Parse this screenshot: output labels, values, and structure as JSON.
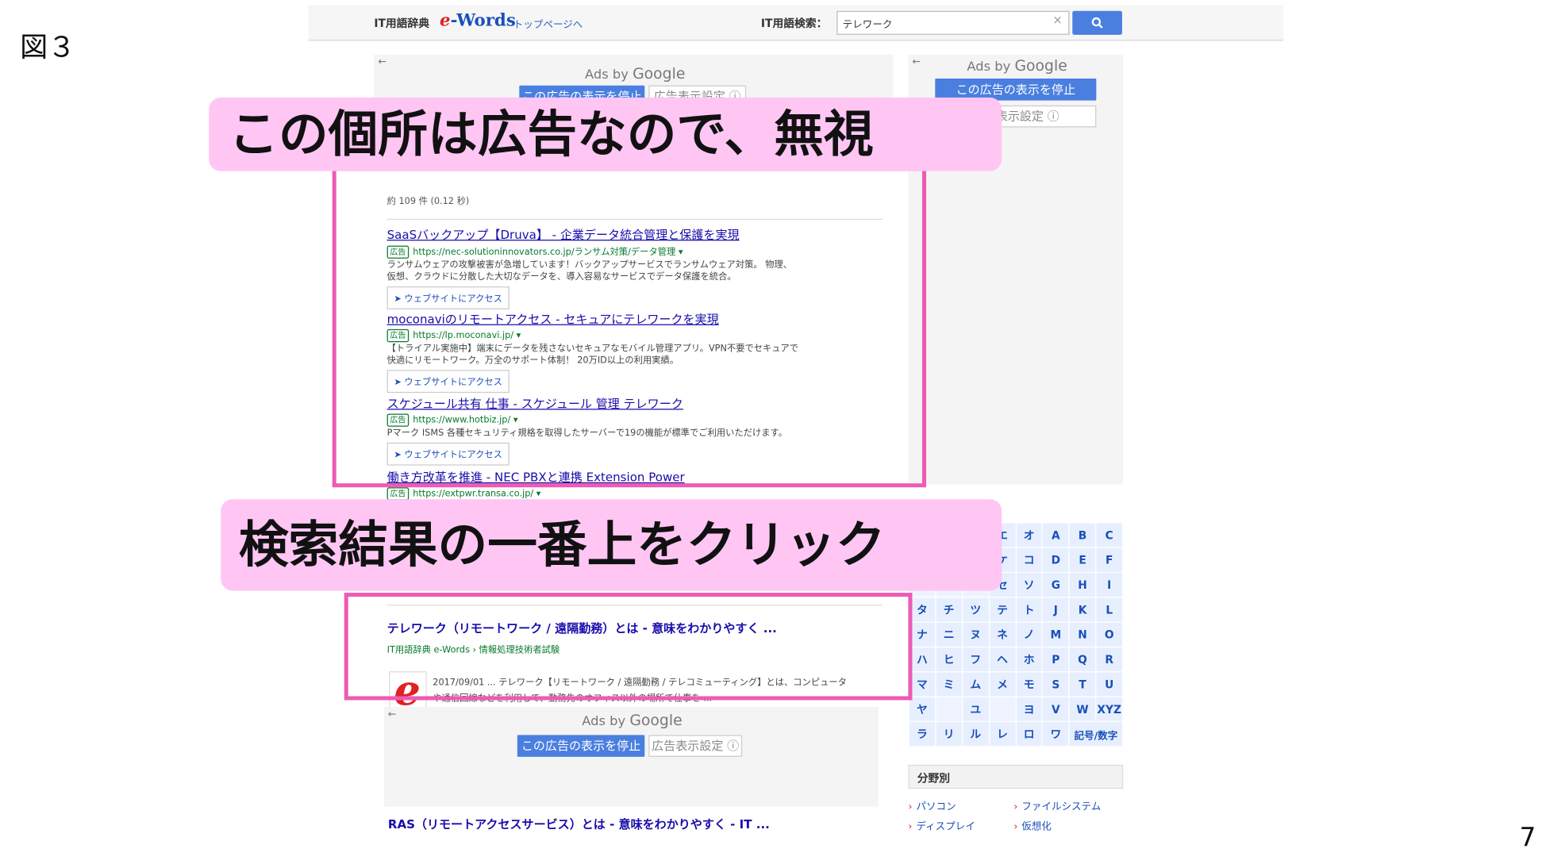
{
  "figure_label": "図３",
  "page_number": "7",
  "header": {
    "brand_label": "IT用語辞典",
    "brand_logo_e": "e",
    "brand_logo_rest": "-Words",
    "top_link": "トップページへ",
    "search_label": "IT用語検索：",
    "search_value": "テレワーク",
    "clear_glyph": "×"
  },
  "ad_blocks": {
    "arrow": "←",
    "ads_by": "Ads by ",
    "google": "Google",
    "stop_label": "この広告の表示を停止",
    "settings_label": "広告表示設定 ⓘ"
  },
  "callouts": {
    "ignore": "この個所は広告なので、無視",
    "click_top": "検索結果の一番上をクリック"
  },
  "results": {
    "count": "約 109 件 (0.12 秒)",
    "ads": [
      {
        "title": "SaaSバックアップ【Druva】 - 企業データ統合管理と保護を実現",
        "badge": "広告",
        "url": "https://nec-solutioninnovators.co.jp/ランサム対策/データ管理 ▾",
        "desc_1": "ランサムウェアの攻撃被害が急増しています！バックアップサービスでランサムウェア対策。 物理、",
        "desc_2": "仮想、クラウドに分散した大切なデータを、導入容易なサービスでデータ保護を統合。",
        "visit": "➤ ウェブサイトにアクセス"
      },
      {
        "title": "moconaviのリモートアクセス - セキュアにテレワークを実現",
        "badge": "広告",
        "url": "https://lp.moconavi.jp/ ▾",
        "desc_1": "【トライアル実施中】端末にデータを残さないセキュアなモバイル管理アプリ。VPN不要でセキュアで",
        "desc_2": "快適にリモートワーク。万全のサポート体制！ 20万ID以上の利用実績。",
        "visit": "➤ ウェブサイトにアクセス"
      },
      {
        "title": "スケジュール共有 仕事 - スケジュール 管理 テレワーク",
        "badge": "広告",
        "url": "https://www.hotbiz.jp/ ▾",
        "desc_1": "Pマーク ISMS 各種セキュリティ規格を取得したサーバーで19の機能が標準でご利用いただけます。",
        "visit": "➤ ウェブサイトにアクセス"
      },
      {
        "title": "働き方改革を推進 - NEC PBXと連携 Extension Power",
        "badge": "広告",
        "url": "https://extpwr.transa.co.jp/ ▾"
      }
    ],
    "organic": {
      "title": "テレワーク（リモートワーク / 遠隔勤務）とは - 意味をわかりやすく ...",
      "crumb": "IT用語辞典 e-Words › 情報処理技術者試験",
      "logo": "e",
      "snippet_1": "2017/09/01 ... テレワーク【リモートワーク / 遠隔勤務 / テレコミューティング】とは、コンピュータ",
      "snippet_2": "や通信回線などを利用して、勤務先のオフィス以外の場所で仕事を ..."
    },
    "next_title": "RAS（リモートアクセスサービス）とは - 意味をわかりやすく - IT ..."
  },
  "kana_rows": [
    [
      "",
      "",
      "",
      "エ",
      "オ",
      "A",
      "B",
      "C"
    ],
    [
      "",
      "",
      "",
      "ケ",
      "コ",
      "D",
      "E",
      "F"
    ],
    [
      "",
      "",
      "",
      "セ",
      "ソ",
      "G",
      "H",
      "I"
    ],
    [
      "タ",
      "チ",
      "ツ",
      "テ",
      "ト",
      "J",
      "K",
      "L"
    ],
    [
      "ナ",
      "ニ",
      "ヌ",
      "ネ",
      "ノ",
      "M",
      "N",
      "O"
    ],
    [
      "ハ",
      "ヒ",
      "フ",
      "ヘ",
      "ホ",
      "P",
      "Q",
      "R"
    ],
    [
      "マ",
      "ミ",
      "ム",
      "メ",
      "モ",
      "S",
      "T",
      "U"
    ],
    [
      "ヤ",
      "",
      "ユ",
      "",
      "ヨ",
      "V",
      "W",
      "XYZ"
    ],
    [
      "ラ",
      "リ",
      "ル",
      "レ",
      "ロ",
      "ワ",
      "記号/数字"
    ]
  ],
  "fields": {
    "heading": "分野別",
    "items": [
      "パソコン",
      "ファイルシステム",
      "ディスプレイ",
      "仮想化"
    ]
  }
}
